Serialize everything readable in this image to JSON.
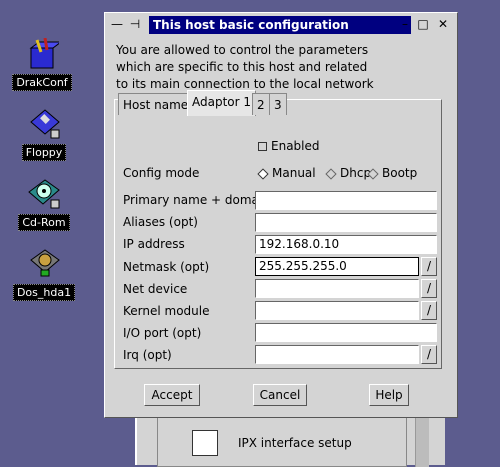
{
  "desktop": {
    "icons": [
      {
        "label": "DrakConf"
      },
      {
        "label": "Floppy"
      },
      {
        "label": "Cd-Rom"
      },
      {
        "label": "Dos_hda1"
      }
    ]
  },
  "back_window": {
    "label": "IPX interface setup"
  },
  "window": {
    "title": "This host basic configuration",
    "controls": {
      "menu": "—",
      "pin": "⊣",
      "minimize": "–",
      "maximize": "□",
      "close": "✕"
    },
    "description": [
      "You are allowed to control the parameters",
      "which are specific to this host and related",
      "to its main connection to the local network"
    ],
    "tabs": [
      {
        "label": "Host name"
      },
      {
        "label": "Adaptor 1"
      },
      {
        "label": "2"
      },
      {
        "label": "3"
      }
    ],
    "enabled_label": "Enabled",
    "config_mode": {
      "label": "Config mode",
      "options": [
        "Manual",
        "Dhcp",
        "Bootp"
      ],
      "selected": "Manual"
    },
    "fields": [
      {
        "label": "Primary name + domain",
        "value": ""
      },
      {
        "label": "Aliases (opt)",
        "value": ""
      },
      {
        "label": "IP address",
        "value": "192.168.0.10"
      },
      {
        "label": "Netmask (opt)",
        "value": "255.255.255.0"
      },
      {
        "label": "Net device",
        "value": ""
      },
      {
        "label": "Kernel module",
        "value": ""
      },
      {
        "label": "I/O port (opt)",
        "value": ""
      },
      {
        "label": "Irq (opt)",
        "value": ""
      }
    ],
    "buttons": {
      "accept": "Accept",
      "cancel": "Cancel",
      "help": "Help"
    }
  }
}
